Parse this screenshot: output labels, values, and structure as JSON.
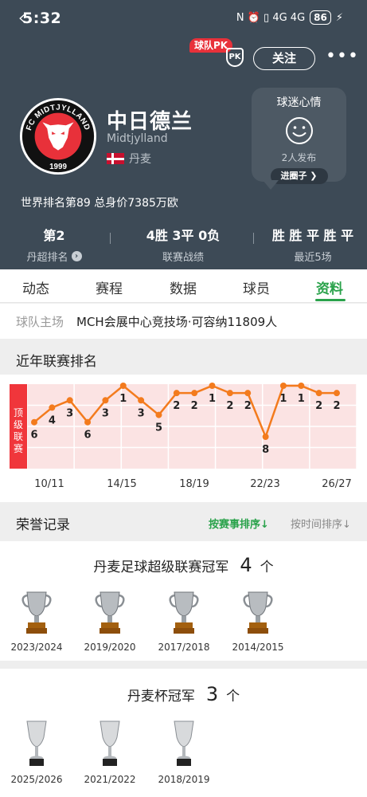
{
  "status_bar": {
    "time": "5:32",
    "battery": "86",
    "icons": "N ⏰ ▯ 4G 4G"
  },
  "nav": {
    "pk_badge": "球队PK",
    "pk_shield": "PK",
    "follow": "关注",
    "more": "•••"
  },
  "team": {
    "name_cn": "中日德兰",
    "name_en": "Midtjylland",
    "country": "丹麦",
    "logo_text_top": "FC MIDTJYLLAND",
    "logo_year": "1999"
  },
  "fan_card": {
    "title": "球迷心情",
    "count": "2人发布",
    "button": "进圈子 ❯"
  },
  "world_rank": "世界排名第89  总身价7385万欧",
  "stats": [
    {
      "value": "第2",
      "label": "丹超排名"
    },
    {
      "value": "4胜 3平 0负",
      "label": "联赛战绩"
    },
    {
      "value": "胜 胜 平 胜 平",
      "label": "最近5场"
    }
  ],
  "tabs": [
    "动态",
    "赛程",
    "数据",
    "球员",
    "资料"
  ],
  "active_tab": "资料",
  "venue": {
    "label": "球队主场",
    "value": "MCH会展中心竞技场·可容纳11809人"
  },
  "league_rank_section": {
    "title": "近年联赛排名"
  },
  "chart_data": {
    "type": "line",
    "band_label": "顶级联赛",
    "x_tick_labels": [
      "10/11",
      "14/15",
      "18/19",
      "22/23",
      "26/27"
    ],
    "values": [
      6,
      4,
      3,
      6,
      3,
      1,
      3,
      5,
      2,
      2,
      1,
      2,
      2,
      8,
      1,
      1,
      2,
      2
    ],
    "ylim": [
      1,
      8
    ],
    "line_color": "#f37b1d",
    "band_color": "#f0363b"
  },
  "honors": {
    "title": "荣誉记录",
    "sort_by_event": "按赛事排序↓",
    "sort_by_time": "按时间排序↓",
    "groups": [
      {
        "title": "丹麦足球超级联赛冠军",
        "count": "4",
        "unit": "个",
        "items": [
          "2023/2024",
          "2019/2020",
          "2017/2018",
          "2014/2015"
        ]
      },
      {
        "title": "丹麦杯冠军",
        "count": "3",
        "unit": "个",
        "items": [
          "2025/2026",
          "2021/2022",
          "2018/2019"
        ]
      }
    ]
  }
}
